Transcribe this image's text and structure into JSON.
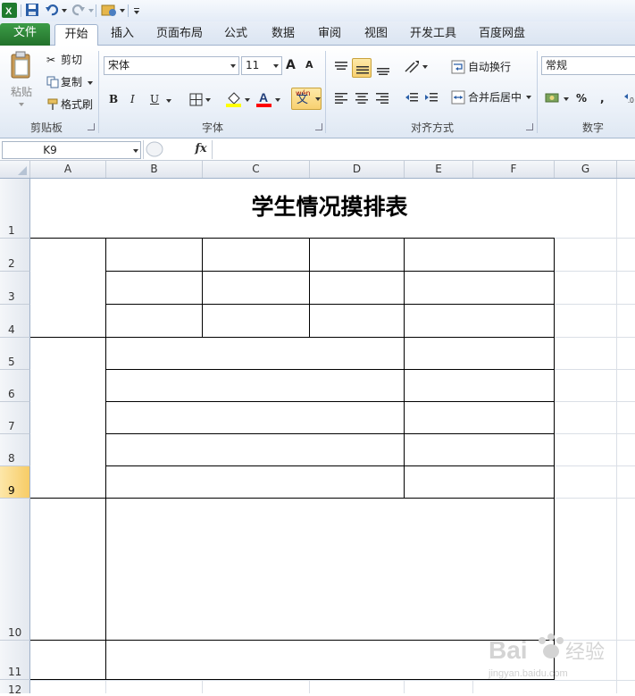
{
  "qat": {
    "undo": "undo-icon",
    "redo": "redo-icon",
    "save": "save-icon"
  },
  "tabs": [
    "文件",
    "开始",
    "插入",
    "页面布局",
    "公式",
    "数据",
    "审阅",
    "视图",
    "开发工具",
    "百度网盘"
  ],
  "clipboard": {
    "paste": "粘贴",
    "cut": "剪切",
    "copy": "复制",
    "format_painter": "格式刷",
    "group": "剪贴板"
  },
  "font": {
    "name": "宋体",
    "size": "11",
    "group": "字体",
    "bold": "B",
    "italic": "I",
    "underline": "U",
    "grow": "A",
    "shrink": "A",
    "phonetic": "wén",
    "phonetic_char": "文"
  },
  "alignment": {
    "wrap": "自动换行",
    "merge": "合并后居中",
    "group": "对齐方式"
  },
  "number": {
    "format": "常规",
    "percent": "%",
    "comma": ",",
    "group": "数字"
  },
  "formula_bar": {
    "namebox": "K9",
    "fx": "fx",
    "value": ""
  },
  "columns": [
    "A",
    "B",
    "C",
    "D",
    "E",
    "F",
    "G"
  ],
  "rows": [
    "1",
    "2",
    "3",
    "4",
    "5",
    "6",
    "7",
    "8",
    "9",
    "10",
    "11",
    "12"
  ],
  "active_row": "9",
  "sheet": {
    "title": "学生情况摸排表"
  },
  "watermark": {
    "brand": "Bai",
    "brand2": "经验",
    "url": "jingyan.baidu.com"
  },
  "colors": {
    "excel_green": "#22712b",
    "selection": "#f7cc66",
    "border": "#000000"
  }
}
